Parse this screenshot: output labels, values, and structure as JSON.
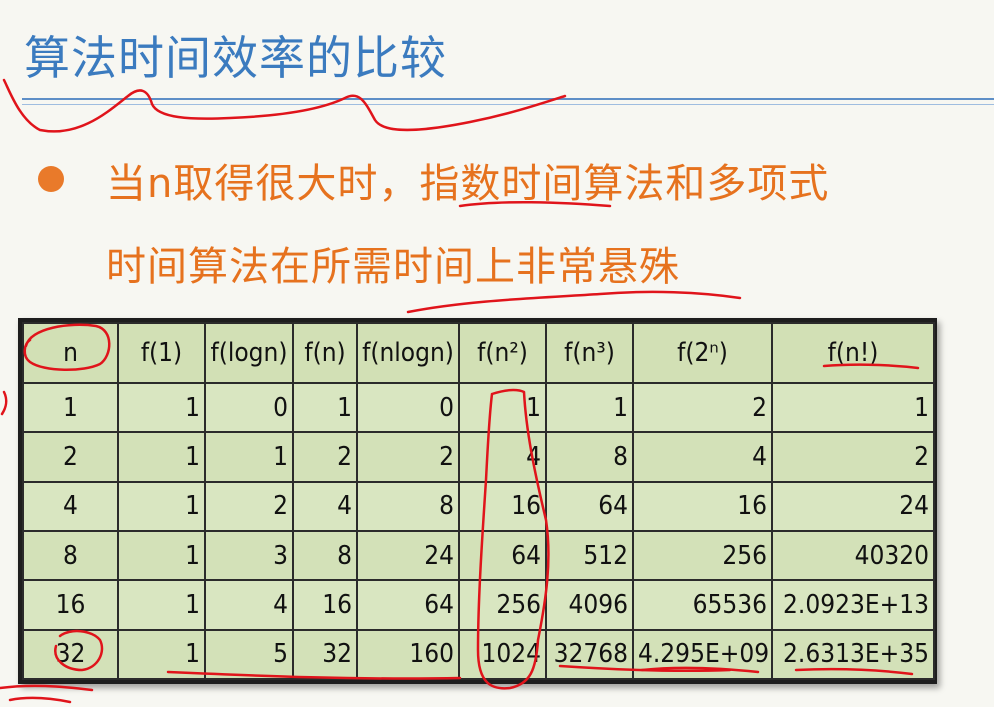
{
  "slide": {
    "title": "算法时间效率的比较",
    "bullet_line1": "当n取得很大时，指数时间算法和多项式",
    "bullet_line2": "时间算法在所需时间上非常悬殊"
  },
  "table": {
    "headers": [
      "n",
      "f(1)",
      "f(logn)",
      "f(n)",
      "f(nlogn)",
      "f(n²)",
      "f(n³)",
      "f(2ⁿ)",
      "f(n!)"
    ],
    "rows": [
      [
        "1",
        "1",
        "0",
        "1",
        "0",
        "1",
        "1",
        "2",
        "1"
      ],
      [
        "2",
        "1",
        "1",
        "2",
        "2",
        "4",
        "8",
        "4",
        "2"
      ],
      [
        "4",
        "1",
        "2",
        "4",
        "8",
        "16",
        "64",
        "16",
        "24"
      ],
      [
        "8",
        "1",
        "3",
        "8",
        "24",
        "64",
        "512",
        "256",
        "40320"
      ],
      [
        "16",
        "1",
        "4",
        "16",
        "64",
        "256",
        "4096",
        "65536",
        "2.0923E+13"
      ],
      [
        "32",
        "1",
        "5",
        "32",
        "160",
        "1024",
        "32768",
        "4.295E+09",
        "2.6313E+35"
      ]
    ]
  },
  "colors": {
    "title": "#3b7bbf",
    "bullet_text": "#e6721e",
    "table_bg": "#d7e4bd",
    "annotation": "#e0141b"
  }
}
